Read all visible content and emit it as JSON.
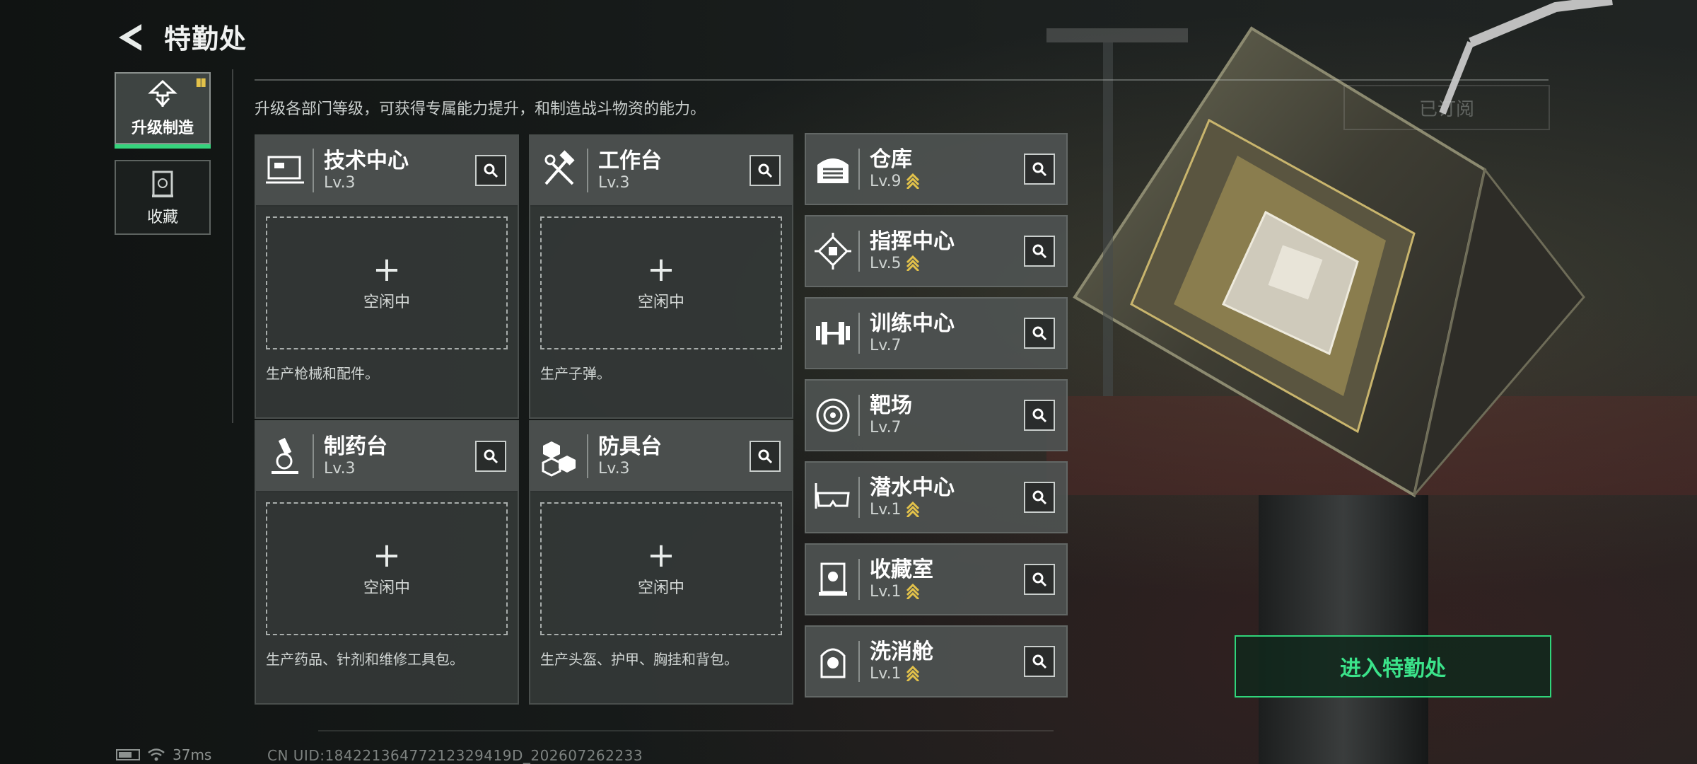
{
  "header": {
    "title": "特勤处"
  },
  "nav": [
    {
      "label": "升级制造",
      "active": true
    },
    {
      "label": "收藏",
      "active": false
    }
  ],
  "description": "升级各部门等级，可获得专属能力提升，和制造战斗物资的能力。",
  "facilities": [
    {
      "name": "技术中心",
      "level": "Lv.3",
      "slot_status": "空闲中",
      "desc": "生产枪械和配件。",
      "icon": "computer-icon"
    },
    {
      "name": "工作台",
      "level": "Lv.3",
      "slot_status": "空闲中",
      "desc": "生产子弹。",
      "icon": "hammer-wrench-icon"
    },
    {
      "name": "制药台",
      "level": "Lv.3",
      "slot_status": "空闲中",
      "desc": "生产药品、针剂和维修工具包。",
      "icon": "microscope-icon"
    },
    {
      "name": "防具台",
      "level": "Lv.3",
      "slot_status": "空闲中",
      "desc": "生产头盔、护甲、胸挂和背包。",
      "icon": "armor-blocks-icon"
    }
  ],
  "departments": [
    {
      "name": "仓库",
      "level": "Lv.9",
      "upgradable": true,
      "icon": "warehouse-icon"
    },
    {
      "name": "指挥中心",
      "level": "Lv.5",
      "upgradable": true,
      "icon": "chip-icon"
    },
    {
      "name": "训练中心",
      "level": "Lv.7",
      "upgradable": false,
      "icon": "dumbbell-icon"
    },
    {
      "name": "靶场",
      "level": "Lv.7",
      "upgradable": false,
      "icon": "target-icon"
    },
    {
      "name": "潜水中心",
      "level": "Lv.1",
      "upgradable": true,
      "icon": "diving-mask-icon"
    },
    {
      "name": "收藏室",
      "level": "Lv.1",
      "upgradable": true,
      "icon": "display-case-icon"
    },
    {
      "name": "洗消舱",
      "level": "Lv.1",
      "upgradable": true,
      "icon": "hazmat-icon"
    }
  ],
  "subscribed_label": "已订阅",
  "enter_button": "进入特勤处",
  "status": {
    "ping": "37ms",
    "uid": "CN UID:18422136477212329419D_20260726223​3"
  },
  "colors": {
    "accent": "#35d47c",
    "upgrade": "#e3c24a",
    "panel": "#4a4e4d"
  }
}
